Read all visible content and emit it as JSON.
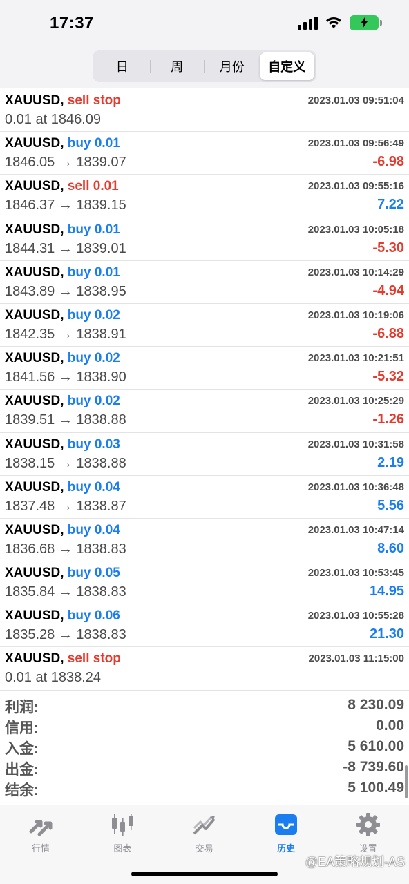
{
  "status_bar": {
    "time": "17:37"
  },
  "period_tabs": [
    {
      "label": "日",
      "active": false
    },
    {
      "label": "周",
      "active": false
    },
    {
      "label": "月份",
      "active": false
    },
    {
      "label": "自定义",
      "active": true
    }
  ],
  "rows": [
    {
      "symbol": "XAUUSD,",
      "direction": "sell stop",
      "side": "sell",
      "time": "2023.01.03 09:51:04",
      "price": "0.01 at 1846.09",
      "profit": "",
      "profit_sign": ""
    },
    {
      "symbol": "XAUUSD,",
      "direction": "buy 0.01",
      "side": "buy",
      "time": "2023.01.03 09:56:49",
      "price": "1846.05 → 1839.07",
      "profit": "-6.98",
      "profit_sign": "neg"
    },
    {
      "symbol": "XAUUSD,",
      "direction": "sell 0.01",
      "side": "sell",
      "time": "2023.01.03 09:55:16",
      "price": "1846.37 → 1839.15",
      "profit": "7.22",
      "profit_sign": "pos"
    },
    {
      "symbol": "XAUUSD,",
      "direction": "buy 0.01",
      "side": "buy",
      "time": "2023.01.03 10:05:18",
      "price": "1844.31 → 1839.01",
      "profit": "-5.30",
      "profit_sign": "neg"
    },
    {
      "symbol": "XAUUSD,",
      "direction": "buy 0.01",
      "side": "buy",
      "time": "2023.01.03 10:14:29",
      "price": "1843.89 → 1838.95",
      "profit": "-4.94",
      "profit_sign": "neg"
    },
    {
      "symbol": "XAUUSD,",
      "direction": "buy 0.02",
      "side": "buy",
      "time": "2023.01.03 10:19:06",
      "price": "1842.35 → 1838.91",
      "profit": "-6.88",
      "profit_sign": "neg"
    },
    {
      "symbol": "XAUUSD,",
      "direction": "buy 0.02",
      "side": "buy",
      "time": "2023.01.03 10:21:51",
      "price": "1841.56 → 1838.90",
      "profit": "-5.32",
      "profit_sign": "neg"
    },
    {
      "symbol": "XAUUSD,",
      "direction": "buy 0.02",
      "side": "buy",
      "time": "2023.01.03 10:25:29",
      "price": "1839.51 → 1838.88",
      "profit": "-1.26",
      "profit_sign": "neg"
    },
    {
      "symbol": "XAUUSD,",
      "direction": "buy 0.03",
      "side": "buy",
      "time": "2023.01.03 10:31:58",
      "price": "1838.15 → 1838.88",
      "profit": "2.19",
      "profit_sign": "pos"
    },
    {
      "symbol": "XAUUSD,",
      "direction": "buy 0.04",
      "side": "buy",
      "time": "2023.01.03 10:36:48",
      "price": "1837.48 → 1838.87",
      "profit": "5.56",
      "profit_sign": "pos"
    },
    {
      "symbol": "XAUUSD,",
      "direction": "buy 0.04",
      "side": "buy",
      "time": "2023.01.03 10:47:14",
      "price": "1836.68 → 1838.83",
      "profit": "8.60",
      "profit_sign": "pos"
    },
    {
      "symbol": "XAUUSD,",
      "direction": "buy 0.05",
      "side": "buy",
      "time": "2023.01.03 10:53:45",
      "price": "1835.84 → 1838.83",
      "profit": "14.95",
      "profit_sign": "pos"
    },
    {
      "symbol": "XAUUSD,",
      "direction": "buy 0.06",
      "side": "buy",
      "time": "2023.01.03 10:55:28",
      "price": "1835.28 → 1838.83",
      "profit": "21.30",
      "profit_sign": "pos"
    },
    {
      "symbol": "XAUUSD,",
      "direction": "sell stop",
      "side": "sell",
      "time": "2023.01.03 11:15:00",
      "price": "0.01 at 1838.24",
      "profit": "",
      "profit_sign": ""
    }
  ],
  "summary": [
    {
      "label": "利润:",
      "value": "8 230.09"
    },
    {
      "label": "信用:",
      "value": "0.00"
    },
    {
      "label": "入金:",
      "value": "5 610.00"
    },
    {
      "label": "出金:",
      "value": "-8 739.60"
    },
    {
      "label": "结余:",
      "value": "5 100.49"
    }
  ],
  "tabbar": [
    {
      "label": "行情",
      "icon": "quotes-arrows-icon",
      "active": false
    },
    {
      "label": "图表",
      "icon": "candlestick-chart-icon",
      "active": false
    },
    {
      "label": "交易",
      "icon": "trade-trend-icon",
      "active": false
    },
    {
      "label": "历史",
      "icon": "history-inbox-icon",
      "active": true
    },
    {
      "label": "设置",
      "icon": "gear-icon",
      "active": false
    }
  ],
  "watermark": "@EA策略规划-AS",
  "colors": {
    "buy": "#1a7ef0",
    "sell": "#e53b2e",
    "active_tab": "#1a7ef0",
    "battery": "#34c759"
  }
}
